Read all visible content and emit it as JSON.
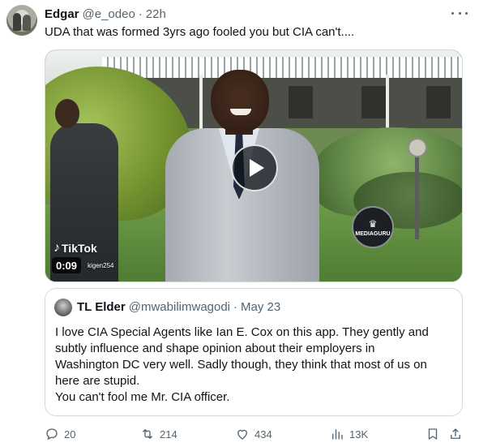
{
  "tweet": {
    "author_name": "Edgar",
    "author_handle": "@e_odeo",
    "separator": "·",
    "time": "22h",
    "text": "UDA that was formed 3yrs ago fooled you but CIA can't...."
  },
  "media": {
    "platform_label": "TikTok",
    "duration": "0:09",
    "uploader": "kigen254",
    "watermark": "MEDIAGURU"
  },
  "quoted_tweet": {
    "author_name": "TL Elder",
    "author_handle": "@mwabilimwagodi",
    "separator": "·",
    "date": "May 23",
    "lines": [
      "I love CIA Special Agents like Ian E. Cox on this app. They gently and",
      "subtly influence and shape opinion about their employers in",
      "Washington DC very well. Sadly though, they think that most of us on",
      "here are stupid.",
      "You can't fool me Mr. CIA officer."
    ]
  },
  "actions": {
    "replies": "20",
    "retweets": "214",
    "likes": "434",
    "views": "13K"
  },
  "colors": {
    "text_primary": "#0f1419",
    "text_secondary": "#536471",
    "border": "#cfd9de"
  }
}
